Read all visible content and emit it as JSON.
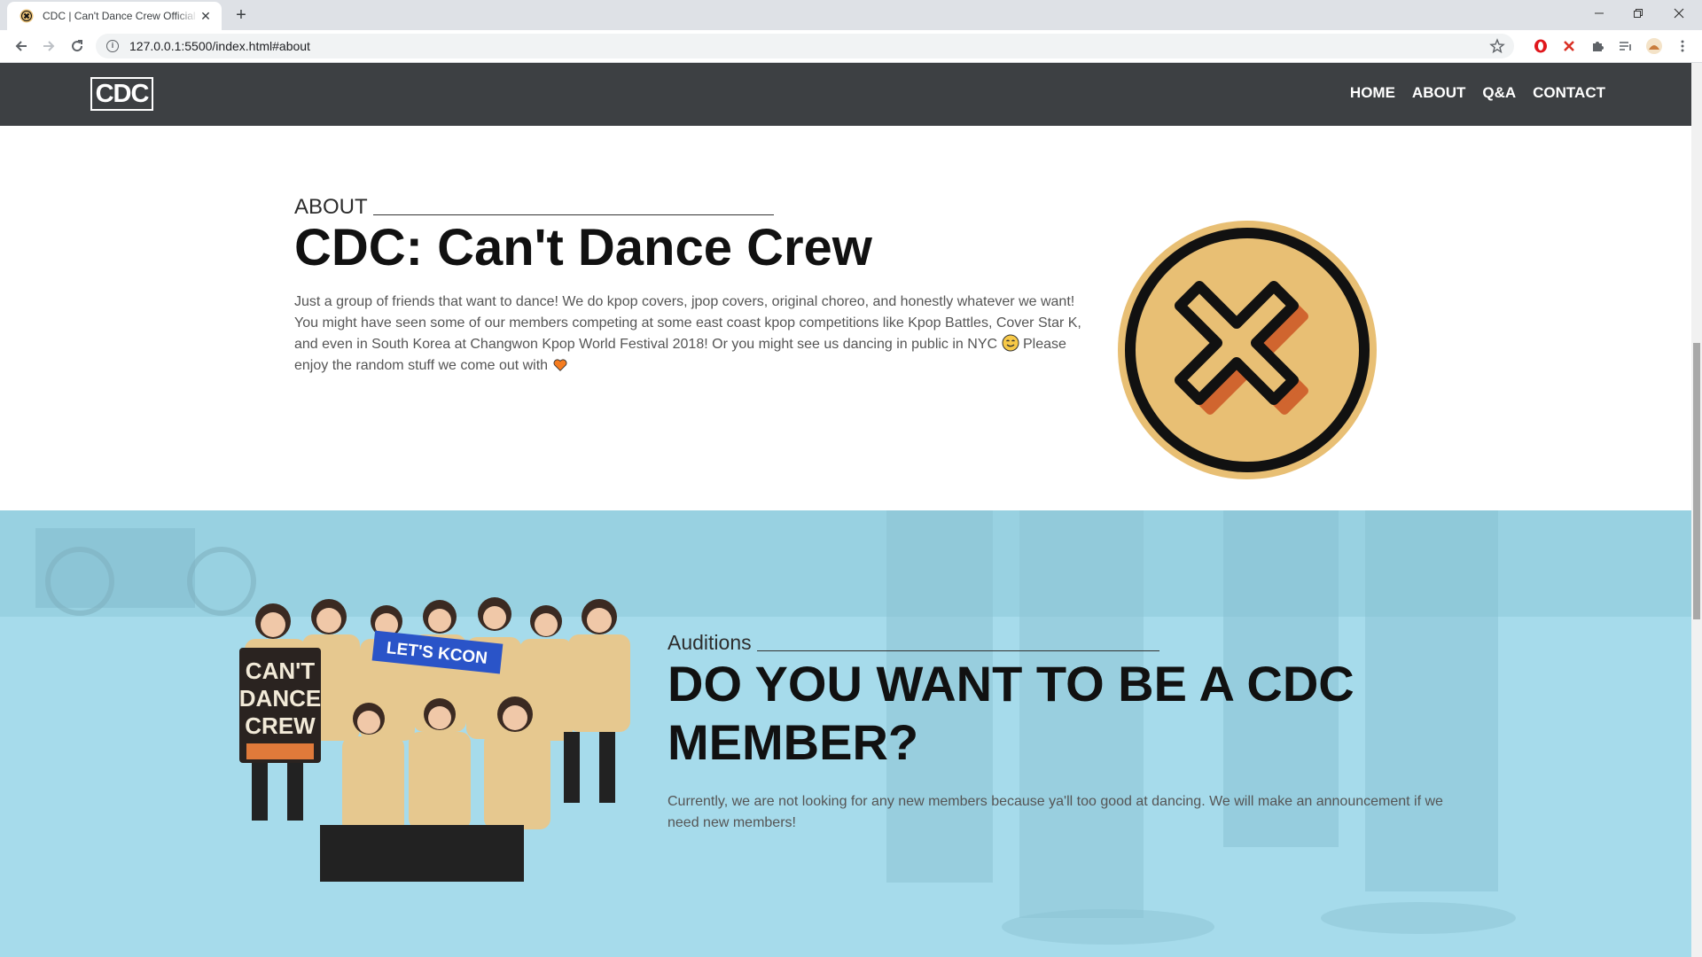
{
  "browser": {
    "tab_title": "CDC | Can't Dance Crew Official Website",
    "new_tab": "+",
    "close_tab": "✕",
    "url": "127.0.0.1:5500/index.html#about"
  },
  "site": {
    "logo": "CDC",
    "nav": [
      "HOME",
      "ABOUT",
      "Q&A",
      "CONTACT"
    ]
  },
  "about": {
    "kicker": "ABOUT",
    "title": "CDC: Can't Dance Crew",
    "text_part1": "Just a group of friends that want to dance! We do kpop covers, jpop covers, original choreo, and honestly whatever we want! You might have seen some of our members competing at some east coast kpop competitions like Kpop Battles, Cover Star K, and even in South Korea at Changwon Kpop World Festival 2018! Or you might see us dancing in public in NYC",
    "text_part2": "Please enjoy the random stuff we come out with",
    "emoji_smile": "smiling-face-icon",
    "emoji_heart": "orange-heart-icon"
  },
  "auditions": {
    "kicker": "Auditions",
    "title": "DO YOU WANT TO BE A CDC MEMBER?",
    "text": "Currently, we are not looking for any new members because ya'll too good at dancing. We will make an announcement if we need new members!",
    "photo_sign_lines": [
      "CAN'T",
      "DANCE",
      "CREW"
    ],
    "photo_banner": "LET'S KCON"
  },
  "colors": {
    "nav_bg": "#3d4043",
    "logo_gold": "#e8bf74",
    "logo_orange": "#d0652f",
    "auditions_bg": "#a5dbeb"
  }
}
